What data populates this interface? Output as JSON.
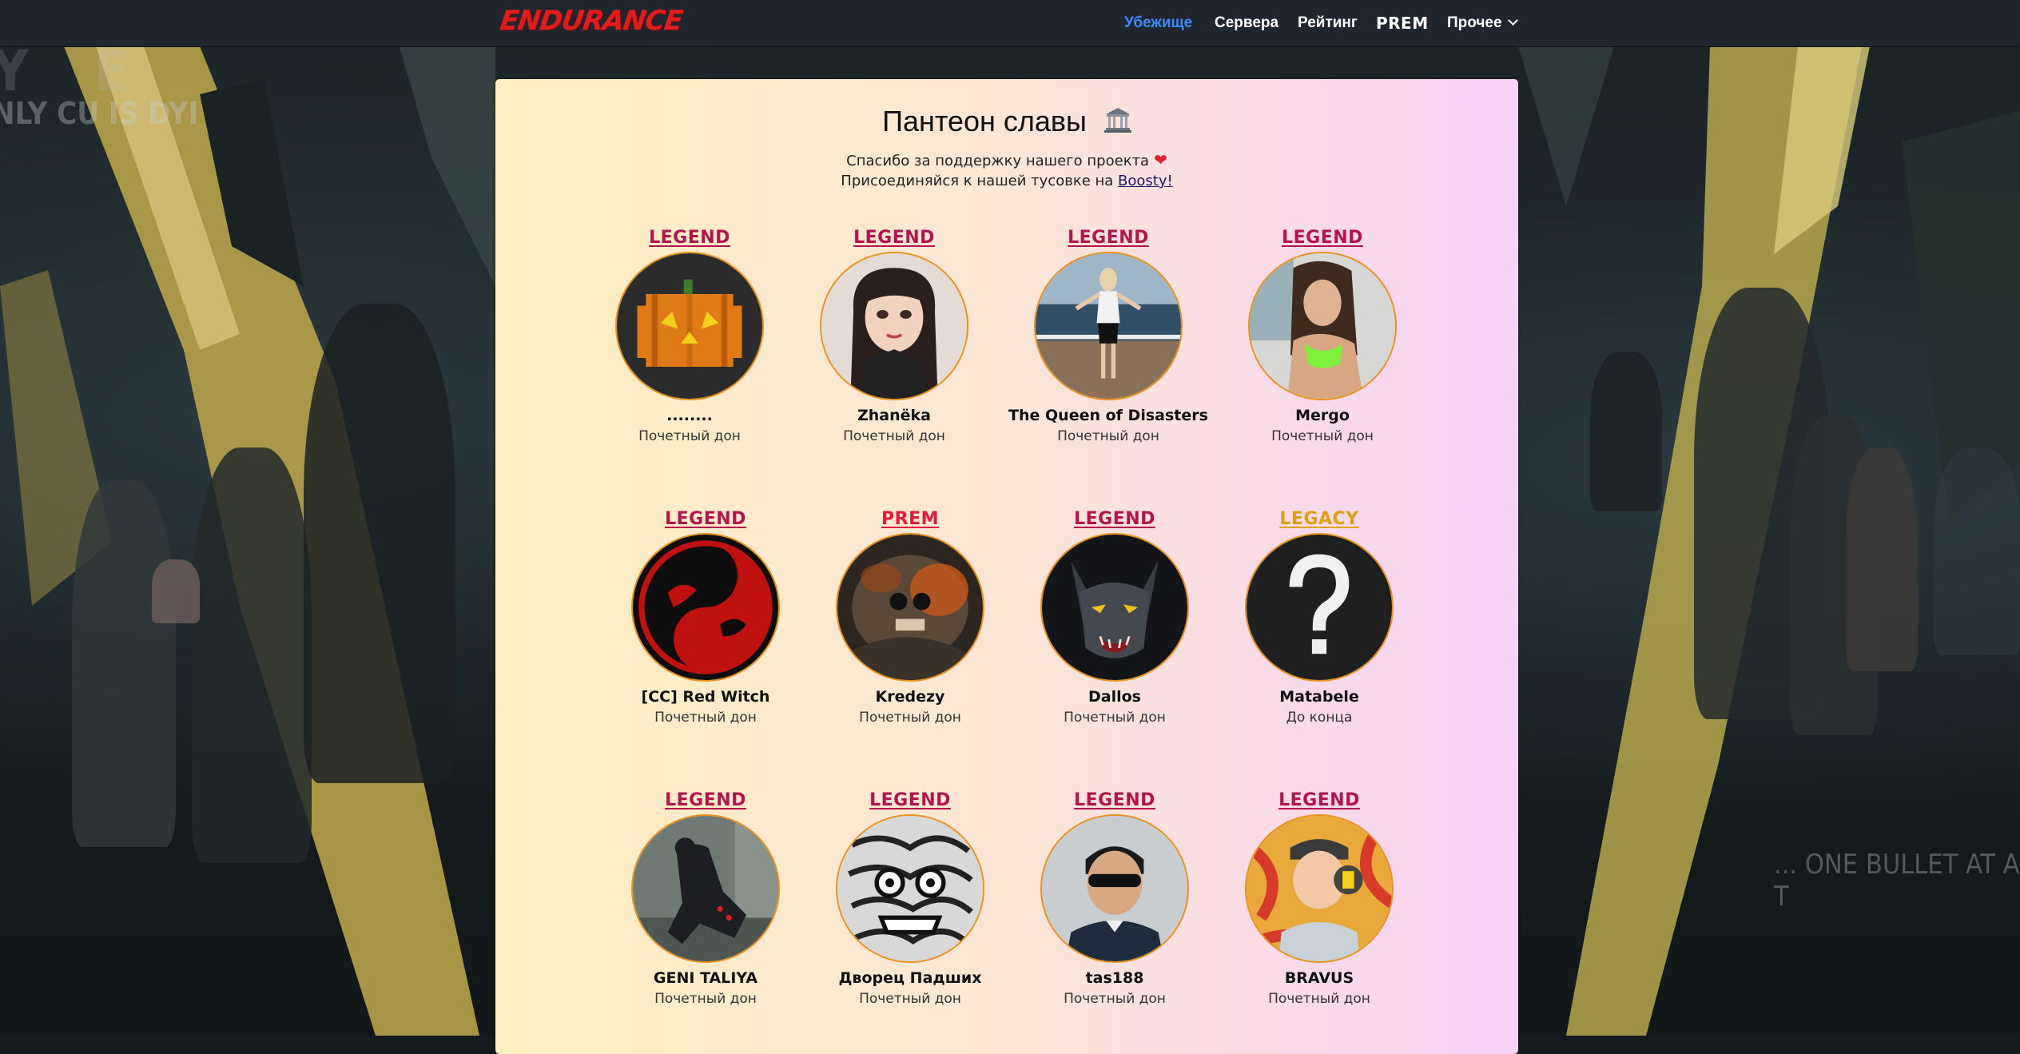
{
  "navbar": {
    "logo": "ENDURANCE",
    "links": [
      {
        "label": "Убежище",
        "active": true
      },
      {
        "label": "Сервера"
      },
      {
        "label": "Рейтинг"
      },
      {
        "label": "PREM"
      },
      {
        "label": "Прочее"
      }
    ]
  },
  "background": {
    "text_top_left": "NLY CU IS DYI",
    "text_top_left_2": "Y E",
    "text_right": "... ONE BULLET AT A T"
  },
  "panel": {
    "title": "Пантеон славы",
    "title_icon": "classical-building-icon",
    "line1": "Спасибо за поддержку нашего проекта",
    "line1_icon": "red-heart-icon",
    "line2_prefix": "Присоединяйся к нашей тусовке на",
    "line2_link": "Boosty!"
  },
  "colors": {
    "legend": "#b5124e",
    "prem": "#e5173f",
    "legacy": "#e0a014",
    "active_link": "#3d8bfd",
    "avatar_border": "#e9921b"
  },
  "donors": [
    {
      "tier": "LEGEND",
      "name": "........",
      "role": "Почетный дон",
      "avatar": "pumpkin-avatar"
    },
    {
      "tier": "LEGEND",
      "name": "Zhanёka",
      "role": "Почетный дон",
      "avatar": "anime-girl-avatar"
    },
    {
      "tier": "LEGEND",
      "name": "The Queen of Disasters",
      "role": "Почетный дон",
      "avatar": "woman-on-pier-avatar"
    },
    {
      "tier": "LEGEND",
      "name": "Mergo",
      "role": "Почетный дон",
      "avatar": "woman-portrait-avatar"
    },
    {
      "tier": "LEGEND",
      "name": "[CC] Red Witch",
      "role": "Почетный дон",
      "avatar": "red-dragon-yinyang-avatar"
    },
    {
      "tier": "PREM",
      "name": "Kredezy",
      "role": "Почетный дон",
      "avatar": "fire-skull-avatar"
    },
    {
      "tier": "LEGEND",
      "name": "Dallos",
      "role": "Почетный дон",
      "avatar": "wolf-avatar"
    },
    {
      "tier": "LEGACY",
      "name": "Matabele",
      "role": "До конца",
      "avatar": "question-mark-avatar"
    },
    {
      "tier": "LEGEND",
      "name": "GENI TALIYA",
      "role": "Почетный дон",
      "avatar": "crouching-figure-avatar"
    },
    {
      "tier": "LEGEND",
      "name": "Дворец Падших",
      "role": "Почетный дон",
      "avatar": "monster-drawing-avatar"
    },
    {
      "tier": "LEGEND",
      "name": "tas188",
      "role": "Почетный дон",
      "avatar": "man-sunglasses-avatar"
    },
    {
      "tier": "LEGEND",
      "name": "BRAVUS",
      "role": "Почетный дон",
      "avatar": "headphones-man-avatar"
    }
  ]
}
